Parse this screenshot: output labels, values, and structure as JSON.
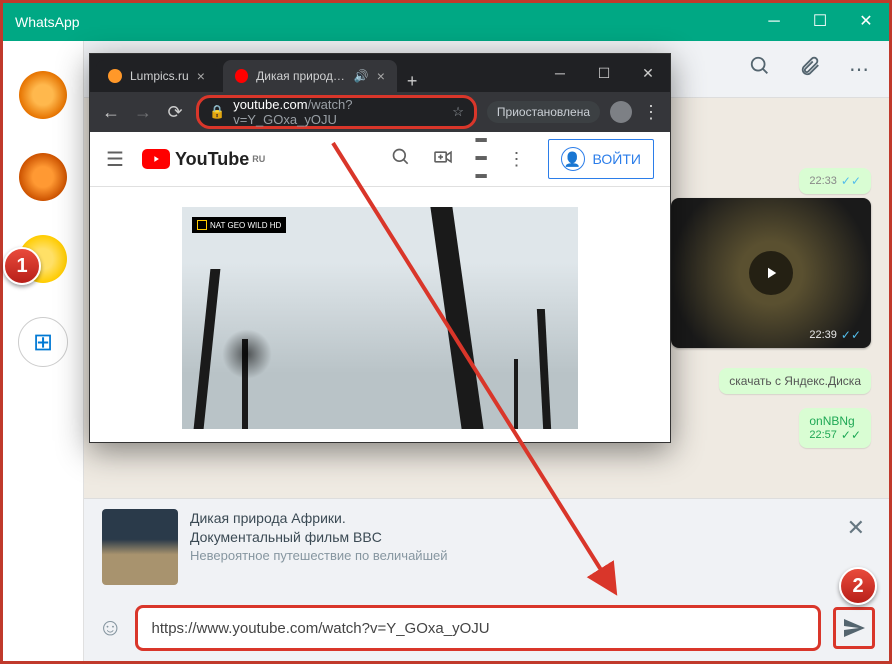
{
  "whatsapp": {
    "title": "WhatsApp",
    "msg1_time": "22:33",
    "video_time": "22:39",
    "msg2_text_a": "скачать с Яндекс.Диска",
    "msg2_time": "",
    "msg3_text": "onNBNg",
    "msg3_time": "22:57",
    "preview": {
      "title1": "Дикая природа Африки.",
      "title2": "Документальный фильм BBC",
      "sub": "Невероятное путешествие по величайшей"
    },
    "input_value": "https://www.youtube.com/watch?v=Y_GOxa_yOJU"
  },
  "browser": {
    "tab1": "Lumpics.ru",
    "tab2": "Дикая природа А",
    "url_host": "youtube.com",
    "url_path": "/watch?v=Y_GOxa_yOJU",
    "paused": "Приостановлена"
  },
  "youtube": {
    "brand": "YouTube",
    "region": "RU",
    "signin": "ВОЙТИ",
    "natgeo": "NAT GEO WILD HD"
  },
  "callouts": {
    "c1": "1",
    "c2": "2"
  }
}
